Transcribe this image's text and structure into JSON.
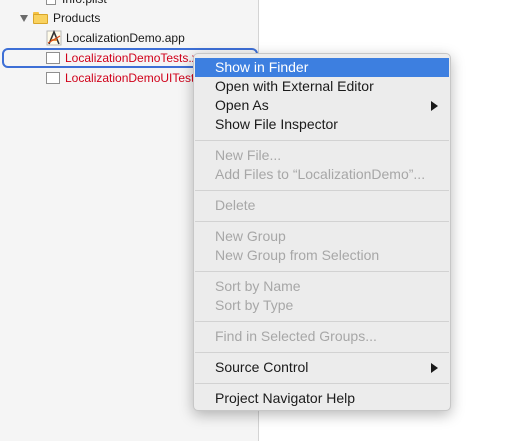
{
  "navigator": {
    "partial_row": "Info.plist",
    "group_products": "Products",
    "file_app": "LocalizationDemo.app",
    "file_tests": "LocalizationDemoTests.x",
    "file_uitests": "LocalizationDemoUITests",
    "colors": {
      "missing_file_text": "#d0021b",
      "selection_outline": "#3d6fd6"
    }
  },
  "context_menu": {
    "items": [
      {
        "label": "Show in Finder",
        "enabled": true,
        "highlighted": true
      },
      {
        "label": "Open with External Editor",
        "enabled": true
      },
      {
        "label": "Open As",
        "enabled": true,
        "submenu": true
      },
      {
        "label": "Show File Inspector",
        "enabled": true
      },
      {
        "label": "New File...",
        "enabled": false
      },
      {
        "label": "Add Files to “LocalizationDemo”...",
        "enabled": false
      },
      {
        "label": "Delete",
        "enabled": false
      },
      {
        "label": "New Group",
        "enabled": false
      },
      {
        "label": "New Group from Selection",
        "enabled": false
      },
      {
        "label": "Sort by Name",
        "enabled": false
      },
      {
        "label": "Sort by Type",
        "enabled": false
      },
      {
        "label": "Find in Selected Groups...",
        "enabled": false
      },
      {
        "label": "Source Control",
        "enabled": true,
        "submenu": true
      },
      {
        "label": "Project Navigator Help",
        "enabled": true
      }
    ],
    "colors": {
      "highlight": "#3d7fe0",
      "disabled_text": "#a7a7a7"
    }
  }
}
